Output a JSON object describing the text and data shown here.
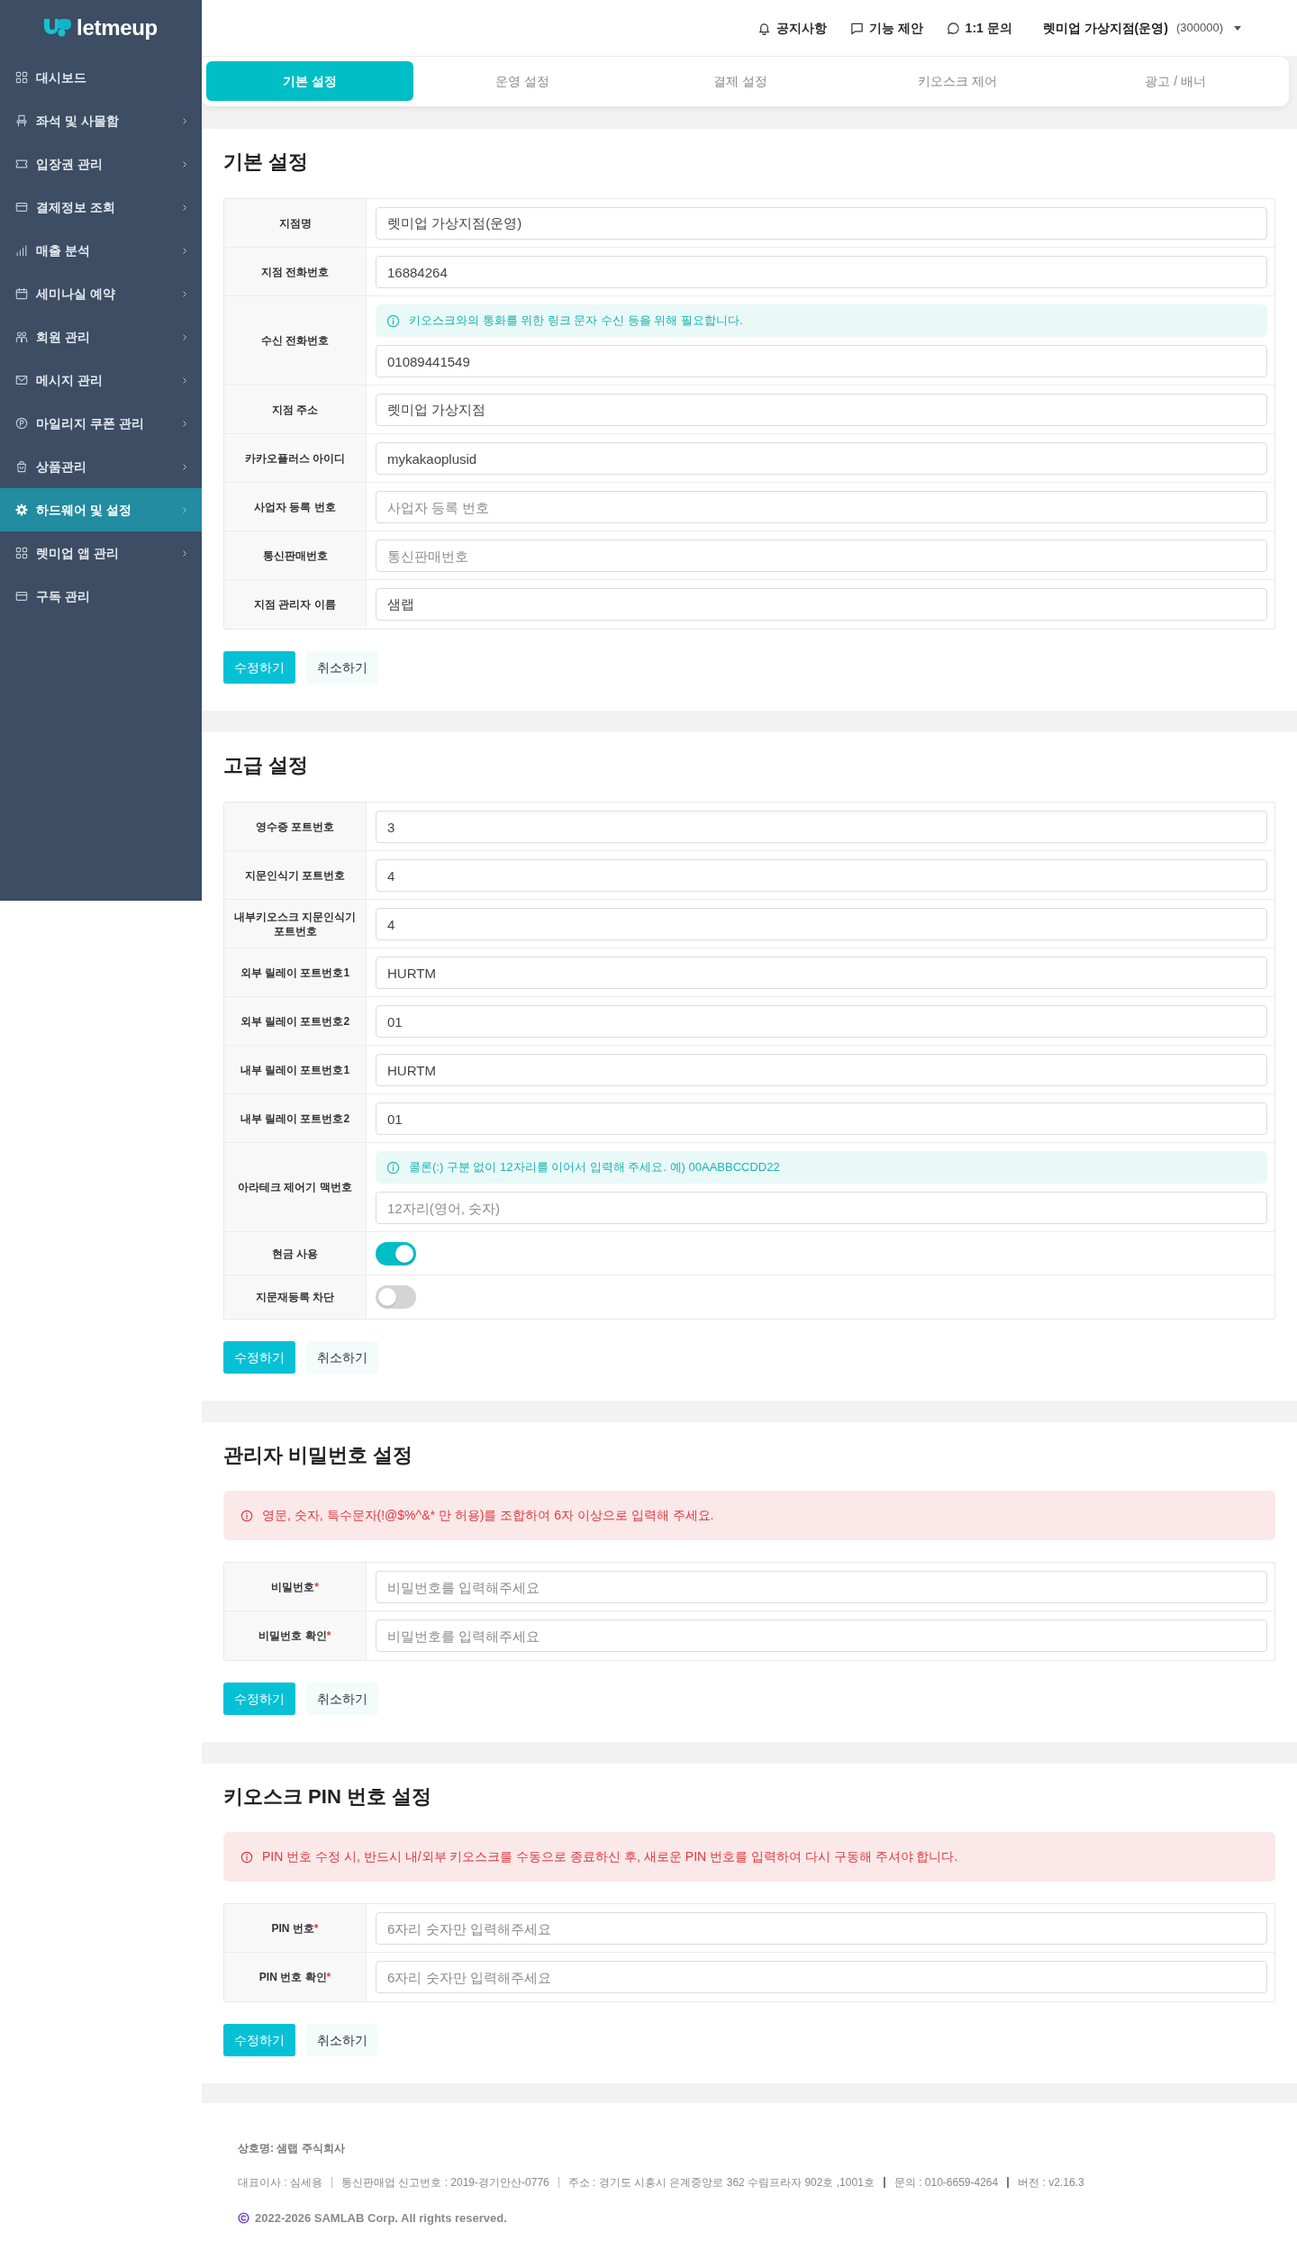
{
  "sidebar": {
    "logo": "letmeup",
    "items": [
      {
        "label": "대시보드",
        "has_submenu": false,
        "selected": false
      },
      {
        "label": "좌석 및 사물함",
        "has_submenu": true,
        "selected": false
      },
      {
        "label": "입장권 관리",
        "has_submenu": true,
        "selected": false
      },
      {
        "label": "결제정보 조회",
        "has_submenu": true,
        "selected": false
      },
      {
        "label": "매출 분석",
        "has_submenu": true,
        "selected": false
      },
      {
        "label": "세미나실 예약",
        "has_submenu": true,
        "selected": false
      },
      {
        "label": "회원 관리",
        "has_submenu": true,
        "selected": false
      },
      {
        "label": "메시지 관리",
        "has_submenu": true,
        "selected": false
      },
      {
        "label": "마일리지 쿠폰 관리",
        "has_submenu": true,
        "selected": false
      },
      {
        "label": "상품관리",
        "has_submenu": true,
        "selected": false
      },
      {
        "label": "하드웨어 및 설정",
        "has_submenu": true,
        "selected": true
      },
      {
        "label": "렛미업 앱 관리",
        "has_submenu": true,
        "selected": false
      },
      {
        "label": "구독 관리",
        "has_submenu": false,
        "selected": false
      }
    ]
  },
  "header": {
    "links": [
      {
        "label": "공지사항"
      },
      {
        "label": "기능 제안"
      },
      {
        "label": "1:1 문의"
      }
    ],
    "account": {
      "name": "렛미업 가상지점(운영)",
      "code": "(300000)"
    }
  },
  "tabs": [
    {
      "label": "기본 설정",
      "selected": true
    },
    {
      "label": "운영 설정",
      "selected": false
    },
    {
      "label": "결제 설정",
      "selected": false
    },
    {
      "label": "키오스크 제어",
      "selected": false
    },
    {
      "label": "광고 / 배너",
      "selected": false
    }
  ],
  "sections": [
    {
      "title": "기본 설정",
      "fields": [
        {
          "label": "지점명",
          "kind": "text",
          "value": "렛미업 가상지점(운영)"
        },
        {
          "label": "지점 전화번호",
          "kind": "text",
          "value": "16884264"
        },
        {
          "label": "수신 전화번호",
          "kind": "text",
          "hint": "키오스크와의 통화를 위한 링크 문자 수신 등을 위해 필요합니다.",
          "value": "01089441549"
        },
        {
          "label": "지점 주소",
          "kind": "text",
          "value": "렛미업 가상지점"
        },
        {
          "label": "카카오플러스 아이디",
          "kind": "text",
          "value": "mykakaoplusid"
        },
        {
          "label": "사업자 등록 번호",
          "kind": "text",
          "placeholder": "사업자 등록 번호"
        },
        {
          "label": "통신판매번호",
          "kind": "text",
          "placeholder": "통신판매번호"
        },
        {
          "label": "지점 관리자 이름",
          "kind": "text",
          "value": "샘랩"
        }
      ],
      "buttons": [
        {
          "label": "수정하기",
          "kind": "primary"
        },
        {
          "label": "취소하기",
          "kind": "secondary"
        }
      ]
    },
    {
      "title": "고급 설정",
      "fields": [
        {
          "label": "영수증 포트번호",
          "kind": "text",
          "value": "3"
        },
        {
          "label": "지문인식기 포트번호",
          "kind": "text",
          "value": "4"
        },
        {
          "label": "내부키오스크 지문인식기 포트번호",
          "kind": "text",
          "value": "4"
        },
        {
          "label": "외부 릴레이 포트번호1",
          "kind": "text",
          "value": "HURTM"
        },
        {
          "label": "외부 릴레이 포트번호2",
          "kind": "text",
          "value": "01"
        },
        {
          "label": "내부 릴레이 포트번호1",
          "kind": "text",
          "value": "HURTM"
        },
        {
          "label": "내부 릴레이 포트번호2",
          "kind": "text",
          "value": "01"
        },
        {
          "label": "아라테크 제어기 맥번호",
          "kind": "text",
          "hint": "콜론(:) 구분 없이 12자리를 이어서 입력해 주세요. 예) 00AABBCCDD22",
          "placeholder": "12자리(영어, 숫자)"
        },
        {
          "label": "현금 사용",
          "kind": "toggle",
          "on": true
        },
        {
          "label": "지문재등록 차단",
          "kind": "toggle",
          "on": false
        }
      ],
      "buttons": [
        {
          "label": "수정하기",
          "kind": "primary"
        },
        {
          "label": "취소하기",
          "kind": "secondary"
        }
      ]
    },
    {
      "title": "관리자 비밀번호 설정",
      "notice": "영문, 숫자, 특수문자(!@$%^&* 만 허용)를 조합하여 6자 이상으로 입력해 주세요.",
      "fields": [
        {
          "label": "비밀번호",
          "required_mark": "*",
          "kind": "text",
          "placeholder": "비밀번호를 입력해주세요"
        },
        {
          "label": "비밀번호 확인",
          "required_mark": "*",
          "kind": "text",
          "placeholder": "비밀번호를 입력해주세요"
        }
      ],
      "buttons": [
        {
          "label": "수정하기",
          "kind": "primary"
        },
        {
          "label": "취소하기",
          "kind": "secondary"
        }
      ]
    },
    {
      "title": "키오스크 PIN 번호 설정",
      "notice": "PIN 번호 수정 시, 반드시 내/외부 키오스크를 수동으로 종료하신 후, 새로운 PIN 번호를 입력하여 다시 구동해 주셔야 합니다.",
      "fields": [
        {
          "label": "PIN 번호",
          "required_mark": "*",
          "kind": "text",
          "placeholder": "6자리 숫자만 입력해주세요"
        },
        {
          "label": "PIN 번호 확인",
          "required_mark": "*",
          "kind": "text",
          "placeholder": "6자리 숫자만 입력해주세요"
        }
      ],
      "buttons": [
        {
          "label": "수정하기",
          "kind": "primary"
        },
        {
          "label": "취소하기",
          "kind": "secondary"
        }
      ]
    }
  ],
  "footer": {
    "company": "상호명: 샘랩 주식회사",
    "details": [
      "대표이사 : 심세용",
      "통신판매업 신고번호 : 2019-경기안산-0776",
      "주소 : 경기도 시흥시 은계중앙로 362 수림프라자 902호 ,1001호",
      "문의 : 010-6659-4264",
      "버전 : v2.16.3"
    ],
    "copyright": "2022-2026 SAMLAB Corp. All rights reserved."
  }
}
